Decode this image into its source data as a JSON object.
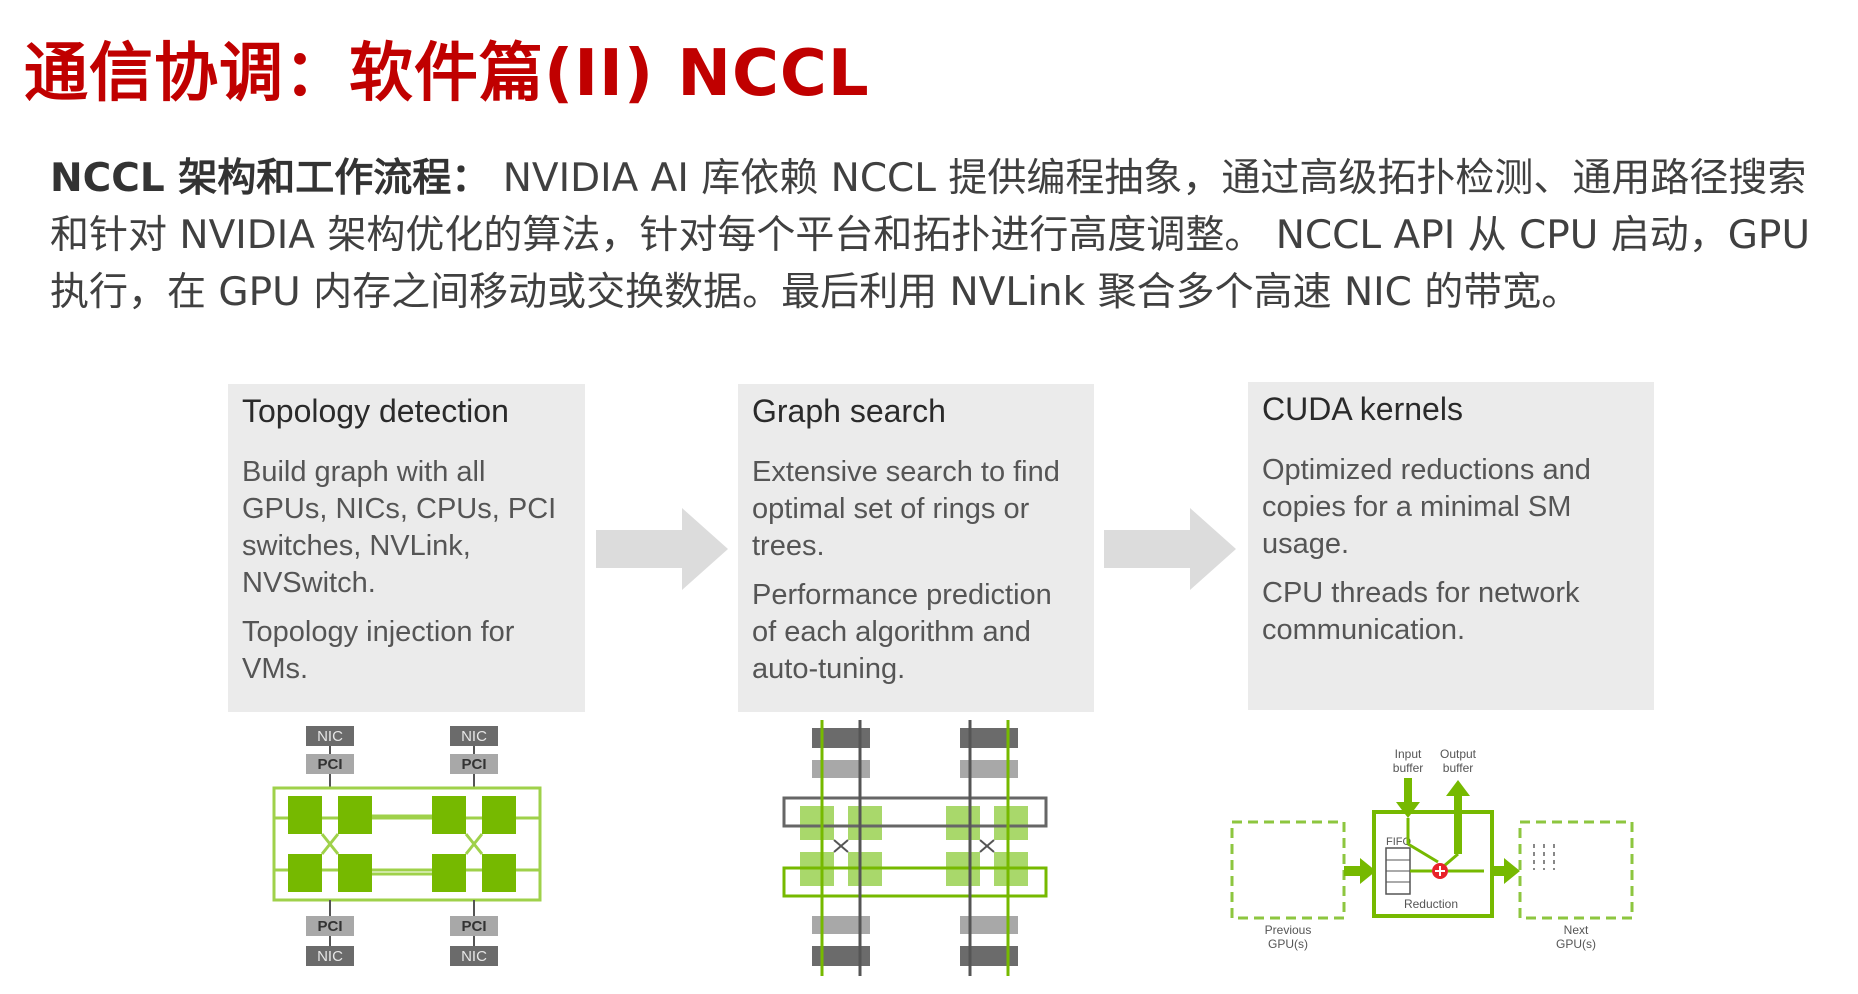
{
  "title": "通信协调：软件篇(II) NCCL",
  "intro": {
    "label": "NCCL 架构和工作流程：",
    "body": " NVIDIA AI 库依赖 NCCL 提供编程抽象，通过高级拓扑检测、通用路径搜索和针对 NVIDIA 架构优化的算法，针对每个平台和拓扑进行高度调整。 NCCL API 从 CPU 启动，GPU 执行，在 GPU 内存之间移动或交换数据。最后利用 NVLink 聚合多个高速 NIC 的带宽。"
  },
  "stages": [
    {
      "title": "Topology detection",
      "paragraphs": [
        "Build graph with all GPUs, NICs, CPUs, PCI switches, NVLink, NVSwitch.",
        "Topology injection for VMs."
      ]
    },
    {
      "title": "Graph search",
      "paragraphs": [
        "Extensive search to find optimal set of rings or trees.",
        "Performance prediction of each algorithm and auto-tuning."
      ]
    },
    {
      "title": "CUDA kernels",
      "paragraphs": [
        "Optimized reductions and copies for a minimal SM usage.",
        "CPU threads for network communication."
      ]
    }
  ],
  "topology_diagram": {
    "nic_label": "NIC",
    "pci_label": "PCI"
  },
  "kernel_diagram": {
    "input_buffer": [
      "Input",
      "buffer"
    ],
    "output_buffer": [
      "Output",
      "buffer"
    ],
    "fifo": "FIFO",
    "reduction": "Reduction",
    "previous": [
      "Previous",
      "GPU(s)"
    ],
    "next": [
      "Next",
      "GPU(s)"
    ]
  },
  "colors": {
    "title_red": "#c00000",
    "box_gray": "#ebebeb",
    "nvidia_green": "#76b900",
    "light_green": "#9fd14a",
    "dark_gray": "#6b6b6b",
    "reduction_red": "#e8232a"
  }
}
